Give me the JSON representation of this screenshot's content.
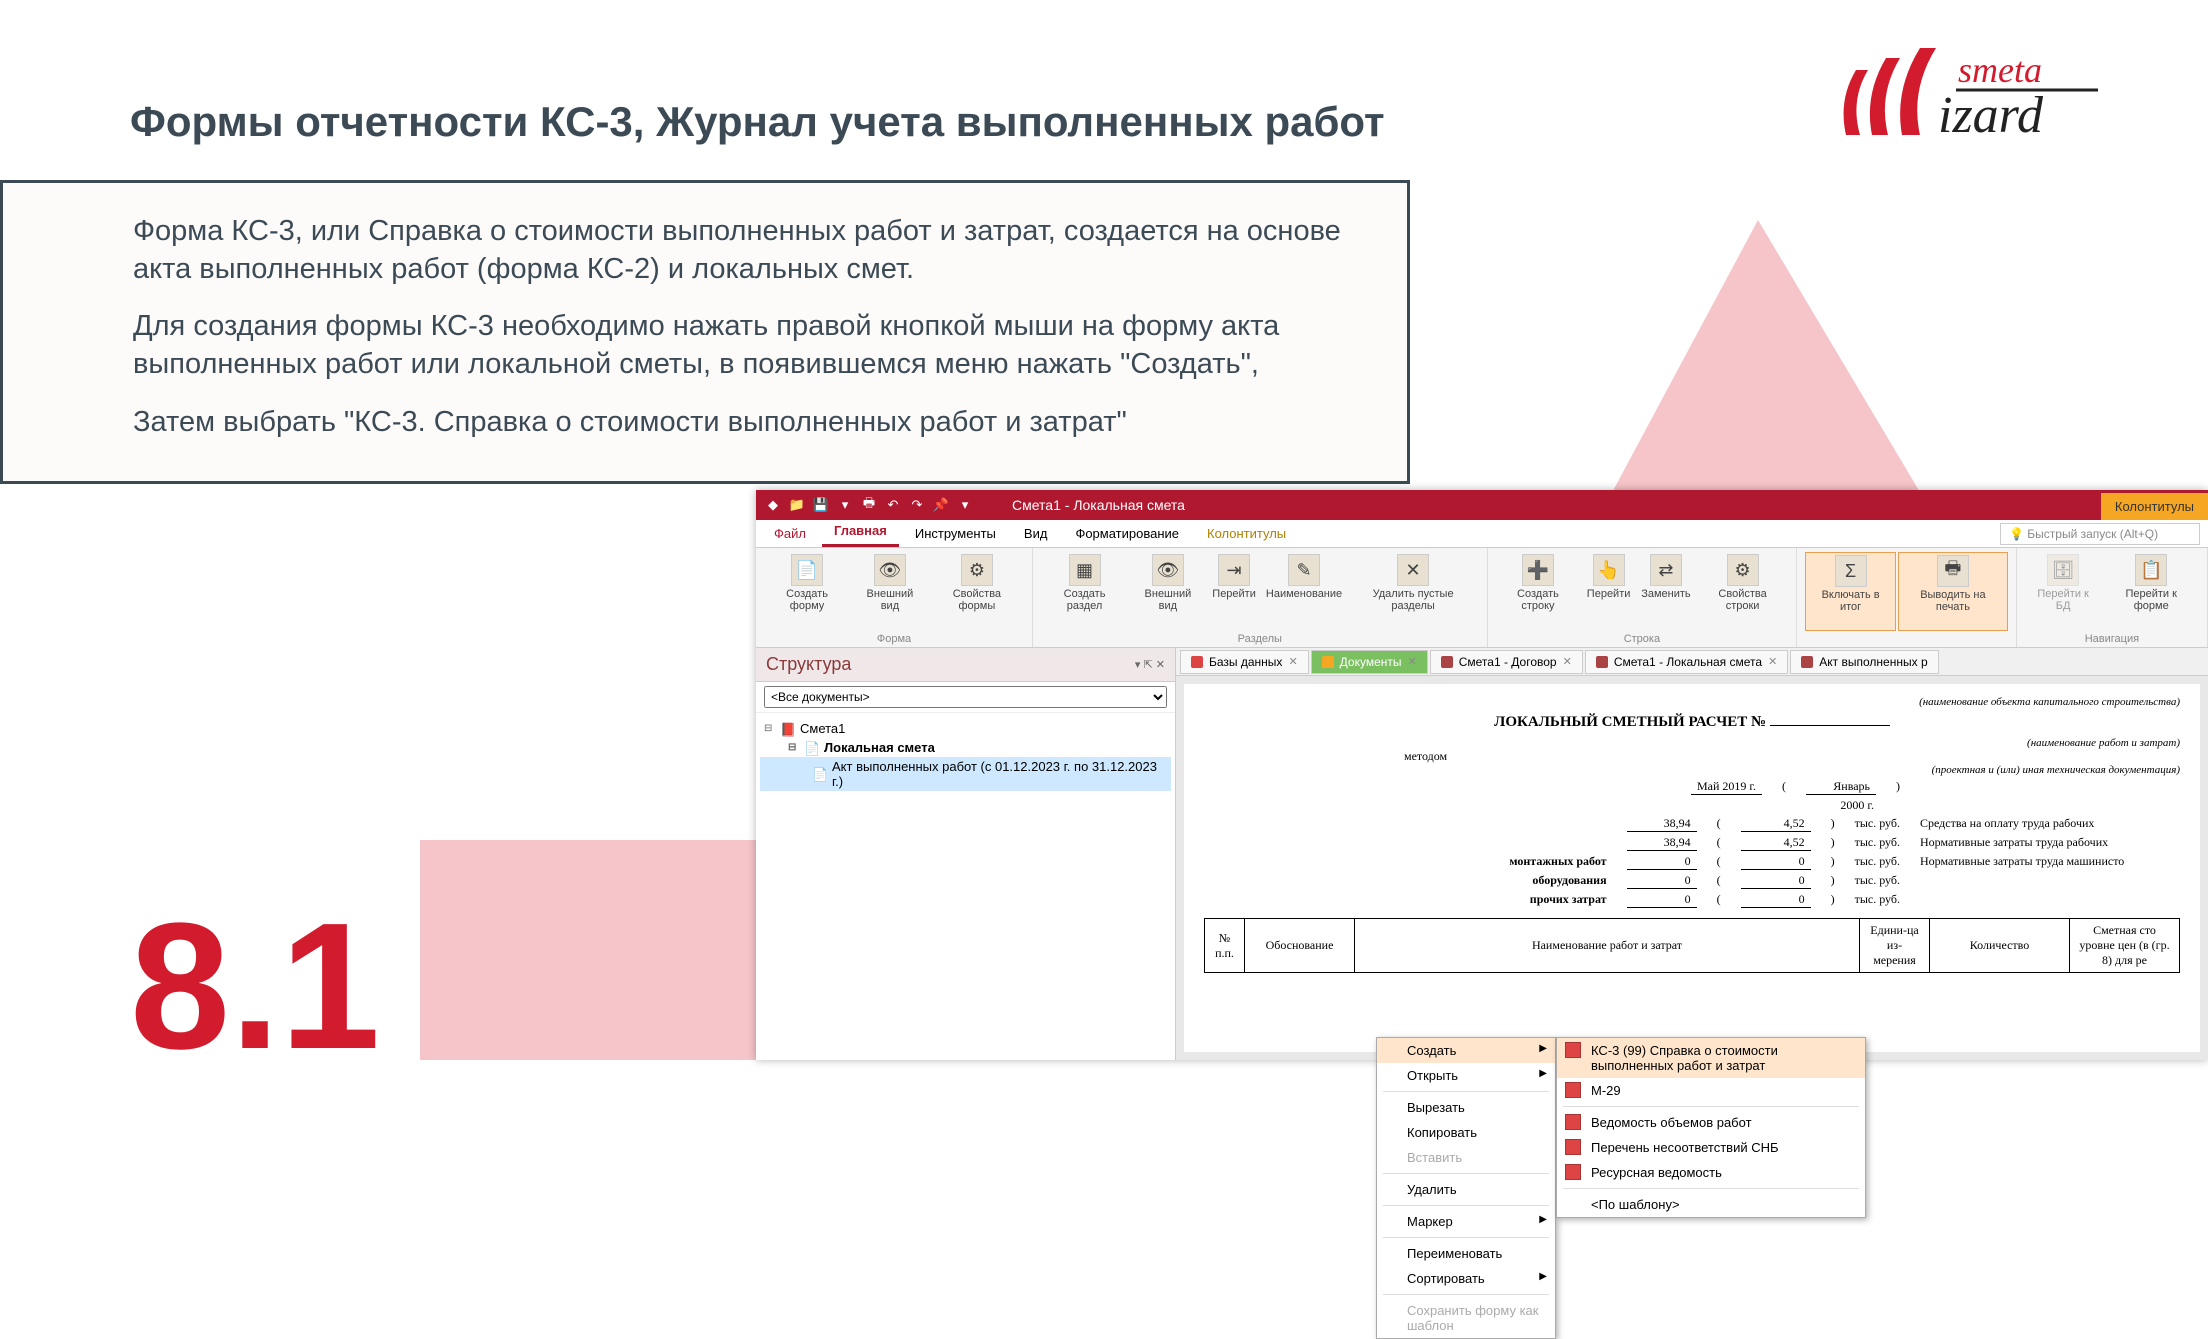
{
  "slide": {
    "title": "Формы отчетности КС-3, Журнал учета выполненных работ",
    "para1": "Форма КС-3, или Справка о стоимости выполненных работ и затрат, создается на основе акта выполненных работ (форма КС-2) и локальных смет.",
    "para2": "Для создания формы КС-3 необходимо нажать правой кнопкой мыши на форму акта выполненных работ или локальной сметы, в появившемся меню нажать \"Создать\",",
    "para3": "Затем выбрать \"КС-3. Справка о стоимости выполненных работ и затрат\"",
    "page_num": "8.1",
    "logo_top": "smeta",
    "logo_bottom": "izard"
  },
  "app": {
    "titlebar": {
      "title": "Смета1 - Локальная смета",
      "context_tab": "Колонтитулы"
    },
    "tabs": {
      "file": "Файл",
      "main": "Главная",
      "tools": "Инструменты",
      "view": "Вид",
      "format": "Форматирование",
      "colont": "Колонтитулы"
    },
    "quick_search_placeholder": "Быстрый запуск (Alt+Q)",
    "ribbon": {
      "g1": {
        "label": "Форма",
        "b1": "Создать форму",
        "b2": "Внешний вид",
        "b3": "Свойства формы"
      },
      "g2": {
        "label": "Разделы",
        "b1": "Создать раздел",
        "b2": "Внешний вид",
        "b3": "Перейти",
        "b4": "Наименование",
        "b5": "Удалить пустые разделы"
      },
      "g3": {
        "label": "Строка",
        "b1": "Создать строку",
        "b2": "Перейти",
        "b3": "Заменить",
        "b4": "Свойства строки"
      },
      "g4": {
        "b1": "Включать в итог",
        "b2": "Выводить на печать"
      },
      "g5": {
        "label": "Навигация",
        "b1": "Перейти к БД",
        "b2": "Перейти к форме"
      }
    },
    "structure": {
      "title": "Структура",
      "filter": "<Все документы>",
      "n1": "Смета1",
      "n2": "Локальная смета",
      "n3": "Акт выполненных работ (с 01.12.2023 г. по 31.12.2023 г.)"
    },
    "ctx": {
      "create": "Создать",
      "open": "Открыть",
      "cut": "Вырезать",
      "copy": "Копировать",
      "paste": "Вставить",
      "delete": "Удалить",
      "marker": "Маркер",
      "rename": "Переименовать",
      "sort": "Сортировать",
      "save_tpl": "Сохранить форму как шаблон"
    },
    "submenu": {
      "ks3": "КС-3 (99) Справка о стоимости выполненных работ и затрат",
      "m29": "М-29",
      "ved": "Ведомость объемов работ",
      "snb": "Перечень несоответствий СНБ",
      "res": "Ресурсная ведомость",
      "tpl": "<По шаблону>"
    },
    "doc_tabs": {
      "t1": "Базы данных",
      "t2": "Документы",
      "t3": "Смета1 - Договор",
      "t4": "Смета1 - Локальная смета",
      "t5": "Акт выполненных р"
    },
    "doc": {
      "note1": "(наименование объекта капитального строительства)",
      "title": "ЛОКАЛЬНЫЙ СМЕТНЫЙ РАСЧЕТ №",
      "note2": "(наименование работ и затрат)",
      "method": "методом",
      "note3": "(проектная и (или) иная техническая документация)",
      "period_date1": "Май 2019 г.",
      "period_date2": "Январь",
      "period_year2": "2000 г.",
      "r1_v1": "38,94",
      "r1_v2": "4,52",
      "r1_unit": "тыс. руб.",
      "r1_desc": "Средства на оплату труда рабочих",
      "r2_v1": "38,94",
      "r2_v2": "4,52",
      "r2_unit": "тыс. руб.",
      "r2_desc": "Нормативные затраты труда рабочих",
      "r3_lbl": "монтажных работ",
      "r3_v1": "0",
      "r3_v2": "0",
      "r3_unit": "тыс. руб.",
      "r3_desc": "Нормативные затраты труда машинисто",
      "r4_lbl": "оборудования",
      "r4_v1": "0",
      "r4_v2": "0",
      "r4_unit": "тыс. руб.",
      "r5_lbl": "прочих затрат",
      "r5_v1": "0",
      "r5_v2": "0",
      "r5_unit": "тыс. руб.",
      "th1": "№ п.п.",
      "th2": "Обоснование",
      "th3": "Наименование работ и затрат",
      "th4": "Едини-ца из-мерения",
      "th5": "Количество",
      "th6": "Сметная сто уровне цен (в (гр. 8) для ре"
    }
  }
}
